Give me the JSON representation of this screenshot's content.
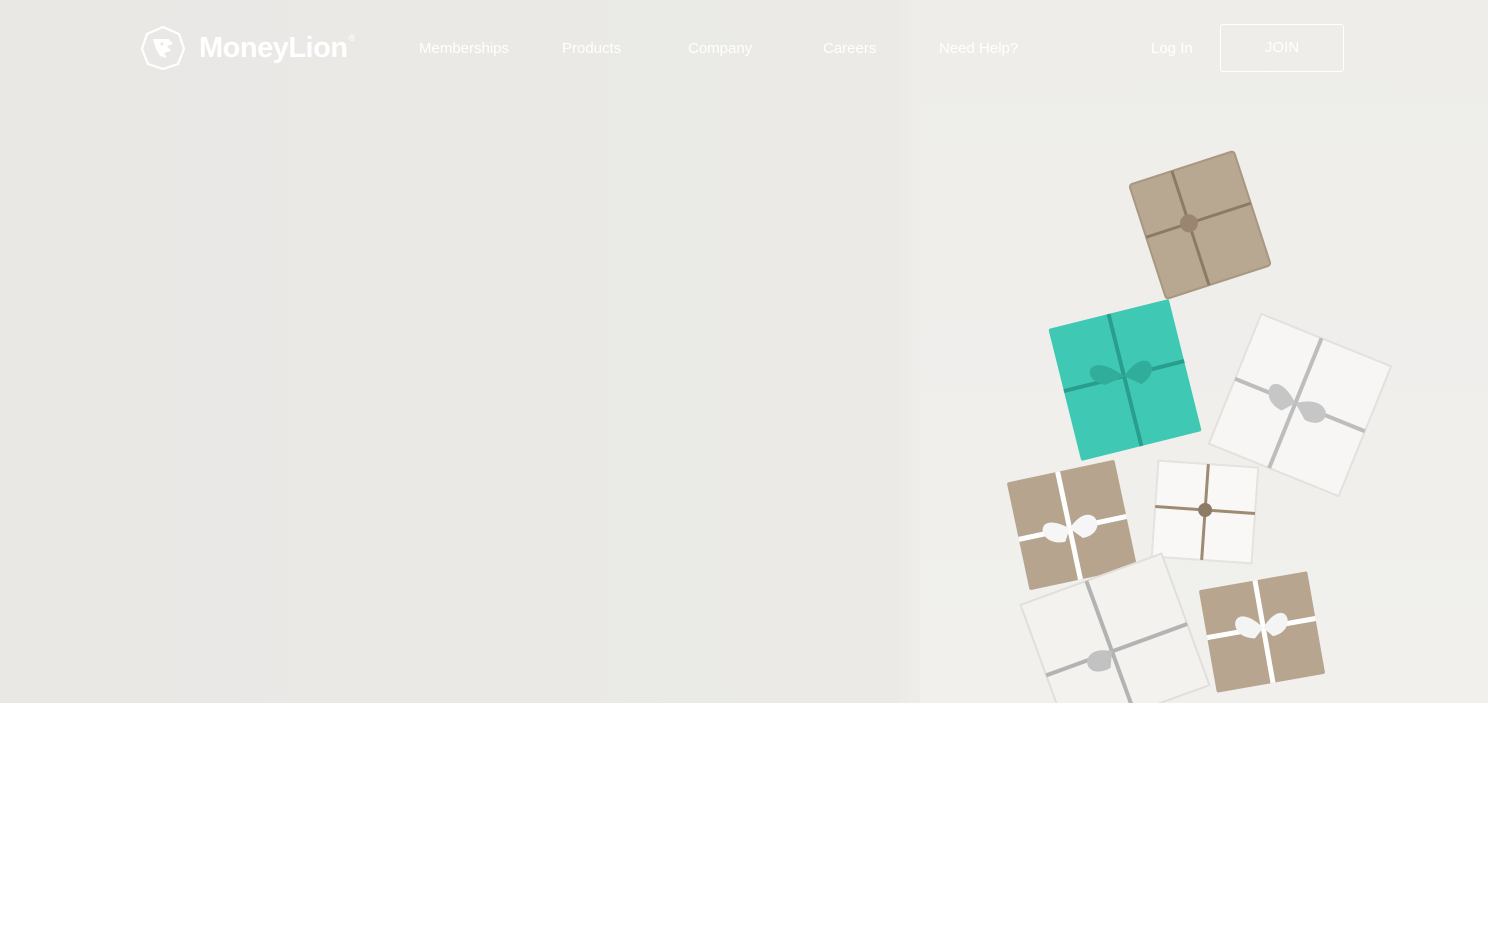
{
  "brand": {
    "name": "MoneyLion",
    "reg": "®"
  },
  "nav": {
    "items": [
      {
        "label": "Memberships"
      },
      {
        "label": "Products"
      },
      {
        "label": "Company"
      },
      {
        "label": "Careers"
      },
      {
        "label": "Need Help?"
      }
    ],
    "login_label": "Log In",
    "join_label": "JOIN"
  },
  "colors": {
    "hero_bg": "#e9e8e5",
    "accent_teal": "#3cc8b4",
    "kraft": "#b9a892",
    "nav_text": "#ffffff"
  }
}
